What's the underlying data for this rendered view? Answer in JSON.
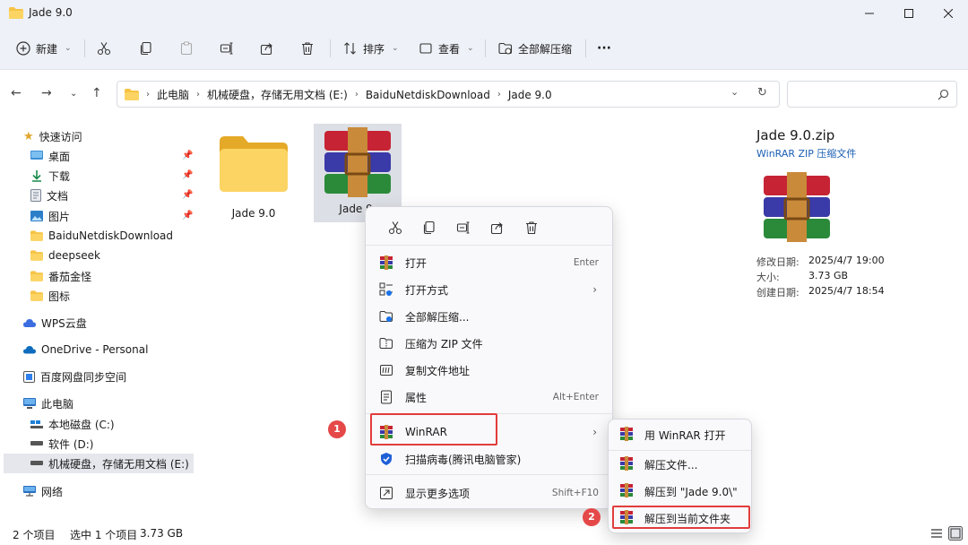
{
  "window": {
    "title": "Jade 9.0"
  },
  "toolbar": {
    "new_label": "新建",
    "sort_label": "排序",
    "view_label": "查看",
    "extract_all_label": "全部解压缩",
    "more_label": "···"
  },
  "address": {
    "crumbs": [
      "此电脑",
      "机械硬盘，存储无用文档 (E:)",
      "BaiduNetdiskDownload",
      "Jade 9.0"
    ],
    "search_placeholder": ""
  },
  "sidebar": {
    "quick_access": "快速访问",
    "items": [
      {
        "label": "桌面"
      },
      {
        "label": "下载"
      },
      {
        "label": "文档"
      },
      {
        "label": "图片"
      },
      {
        "label": "BaiduNetdiskDownload"
      },
      {
        "label": "deepseek"
      },
      {
        "label": "番茄金怪"
      },
      {
        "label": "图标"
      }
    ],
    "wps": "WPS云盘",
    "onedrive": "OneDrive - Personal",
    "baidu_sync": "百度网盘同步空间",
    "this_pc": "此电脑",
    "drives": [
      {
        "label": "本地磁盘 (C:)"
      },
      {
        "label": "软件 (D:)"
      },
      {
        "label": "机械硬盘，存储无用文档 (E:)"
      }
    ],
    "network": "网络"
  },
  "files": [
    {
      "name": "Jade 9.0",
      "icon": "folder-icon"
    },
    {
      "name": "Jade 9.0.zip",
      "display_name": "Jade 9.",
      "icon": "winrar-icon"
    }
  ],
  "details": {
    "name": "Jade 9.0.zip",
    "type": "WinRAR ZIP 压缩文件",
    "modified_label": "修改日期:",
    "modified_value": "2025/4/7 19:00",
    "size_label": "大小:",
    "size_value": "3.73 GB",
    "created_label": "创建日期:",
    "created_value": "2025/4/7 18:54"
  },
  "context_menu": {
    "items": [
      {
        "label": "打开",
        "shortcut": "Enter"
      },
      {
        "label": "打开方式"
      },
      {
        "label": "全部解压缩..."
      },
      {
        "label": "压缩为 ZIP 文件"
      },
      {
        "label": "复制文件地址"
      },
      {
        "label": "属性",
        "shortcut": "Alt+Enter"
      },
      {
        "label": "WinRAR"
      },
      {
        "label": "扫描病毒(腾讯电脑管家)"
      },
      {
        "label": "显示更多选项",
        "shortcut": "Shift+F10"
      }
    ]
  },
  "submenu": {
    "items": [
      {
        "label": "用 WinRAR 打开"
      },
      {
        "label": "解压文件..."
      },
      {
        "label": "解压到 \"Jade 9.0\\\""
      },
      {
        "label": "解压到当前文件夹"
      }
    ]
  },
  "annotations": {
    "step1": "1",
    "step2": "2"
  },
  "status": {
    "items_count": "2 个项目",
    "selected": "选中 1 个项目",
    "selected_size": "3.73 GB"
  },
  "colors": {
    "accent": "#1a5fb4",
    "highlight": "#e23c3c",
    "folder": "#f6c344"
  }
}
